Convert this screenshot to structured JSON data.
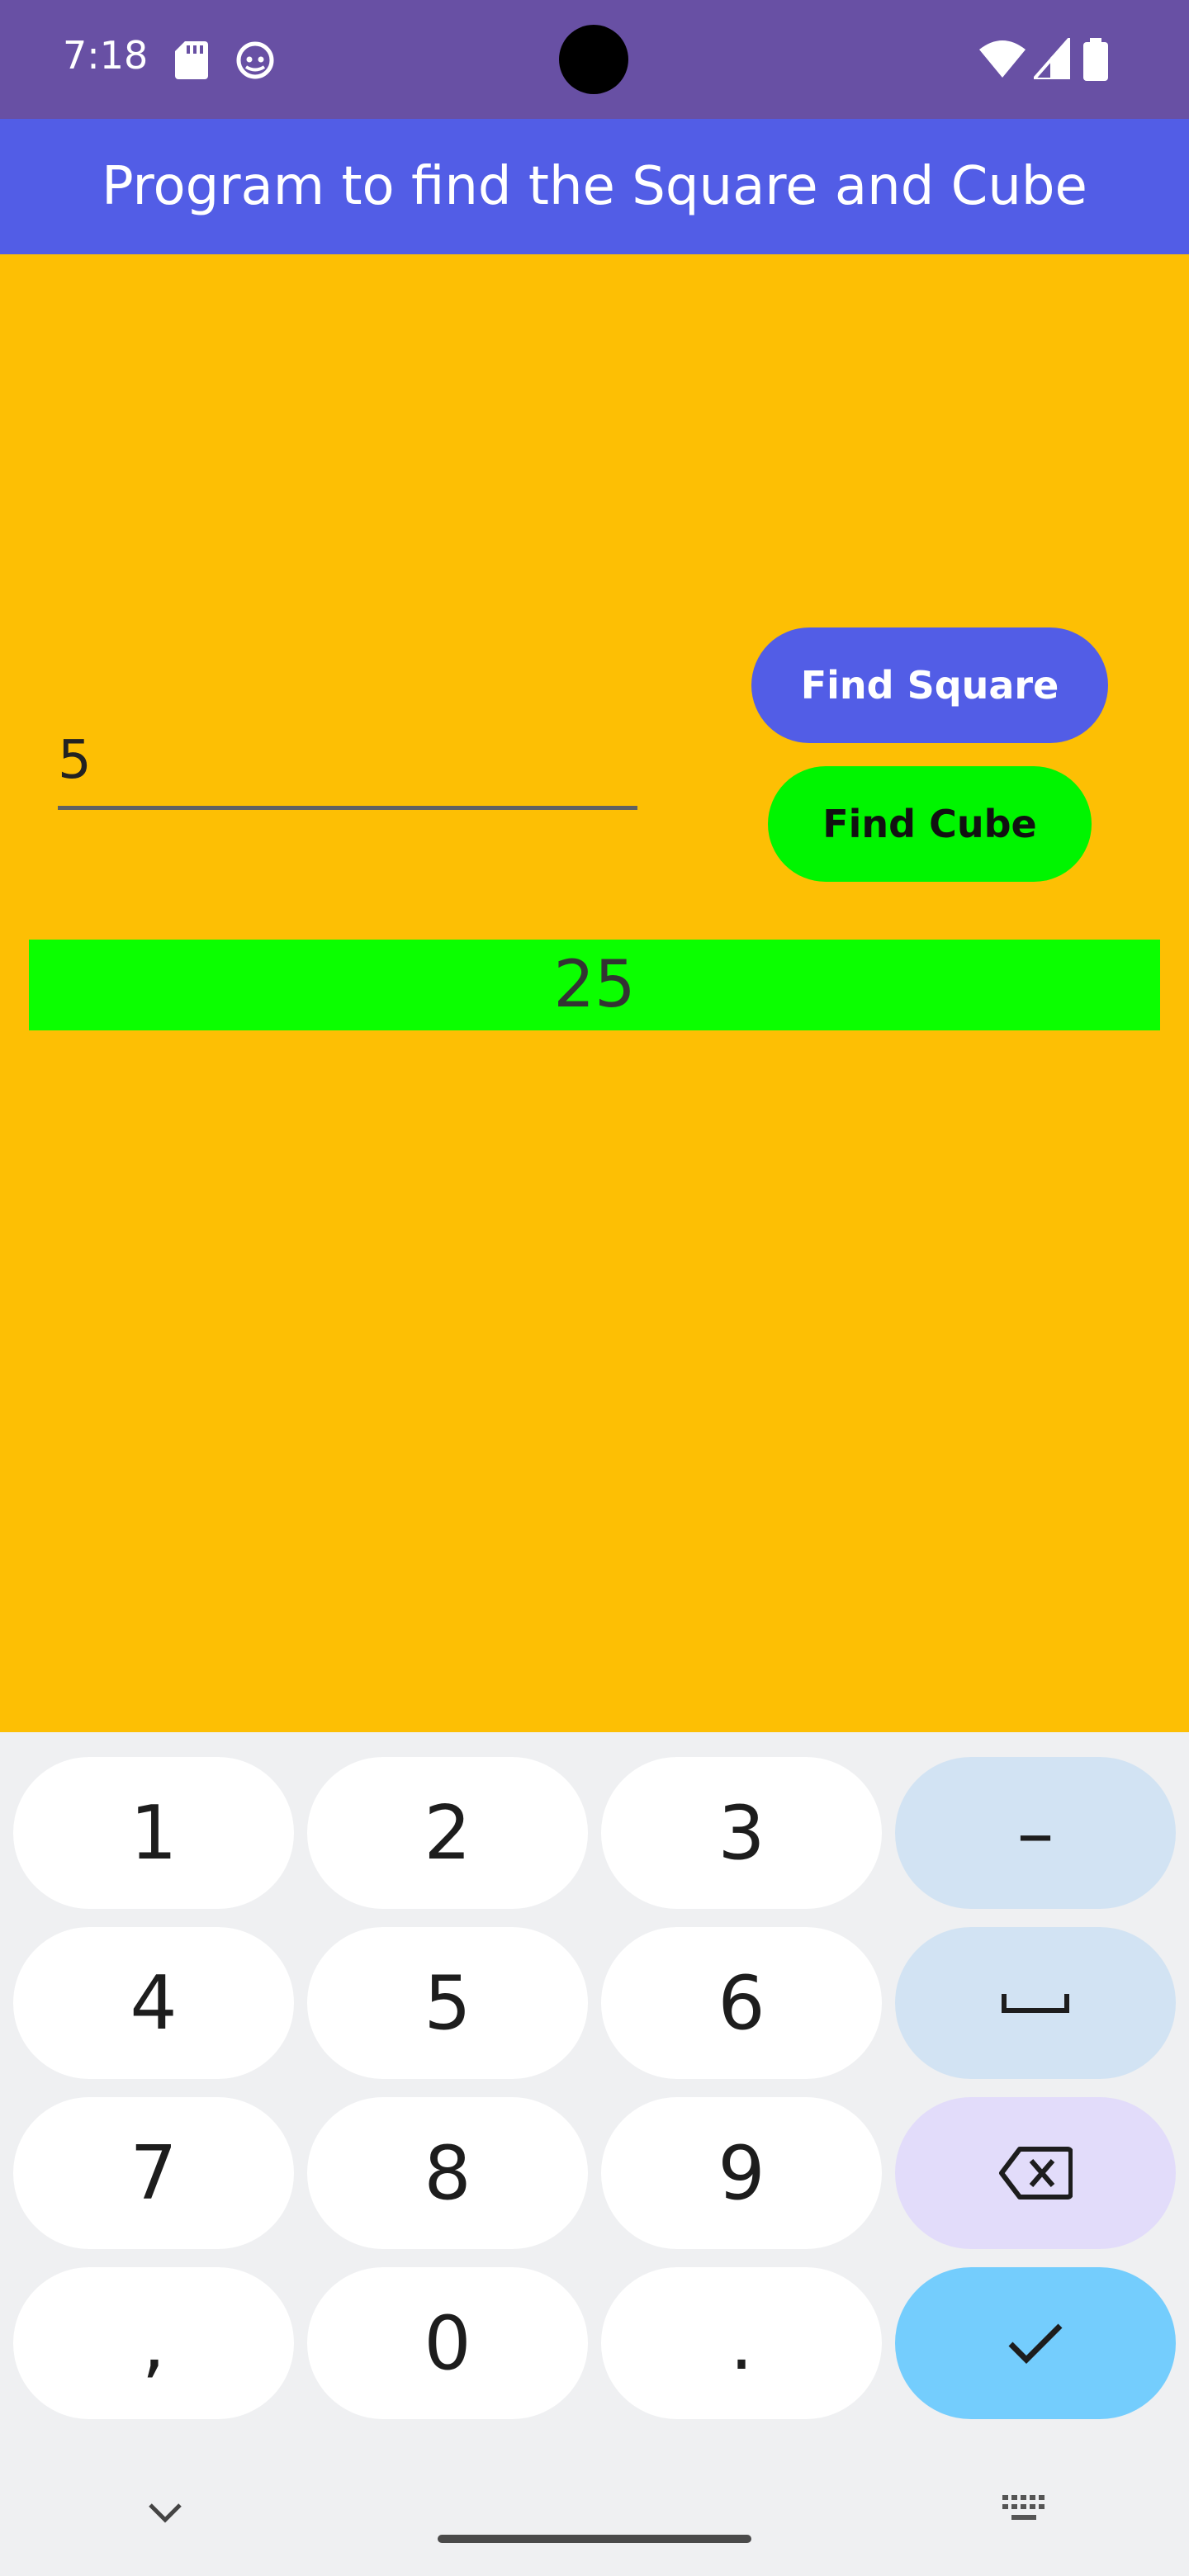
{
  "status_bar": {
    "time": "7:18"
  },
  "app_bar": {
    "title": "Program to find the Square and Cube"
  },
  "form": {
    "input_value": "5",
    "find_square_label": "Find Square",
    "find_cube_label": "Find Cube",
    "result": "25"
  },
  "keyboard": {
    "rows": [
      [
        "1",
        "2",
        "3",
        "–"
      ],
      [
        "4",
        "5",
        "6",
        "space"
      ],
      [
        "7",
        "8",
        "9",
        "backspace"
      ],
      [
        ",",
        "0",
        ".",
        "done"
      ]
    ]
  },
  "colors": {
    "status_bar": "#6850a4",
    "app_bar": "#525de6",
    "background": "#fdbf04",
    "result_bg": "#0bff00",
    "find_cube_bg": "#00f500",
    "enter_key": "#74cdfd"
  }
}
